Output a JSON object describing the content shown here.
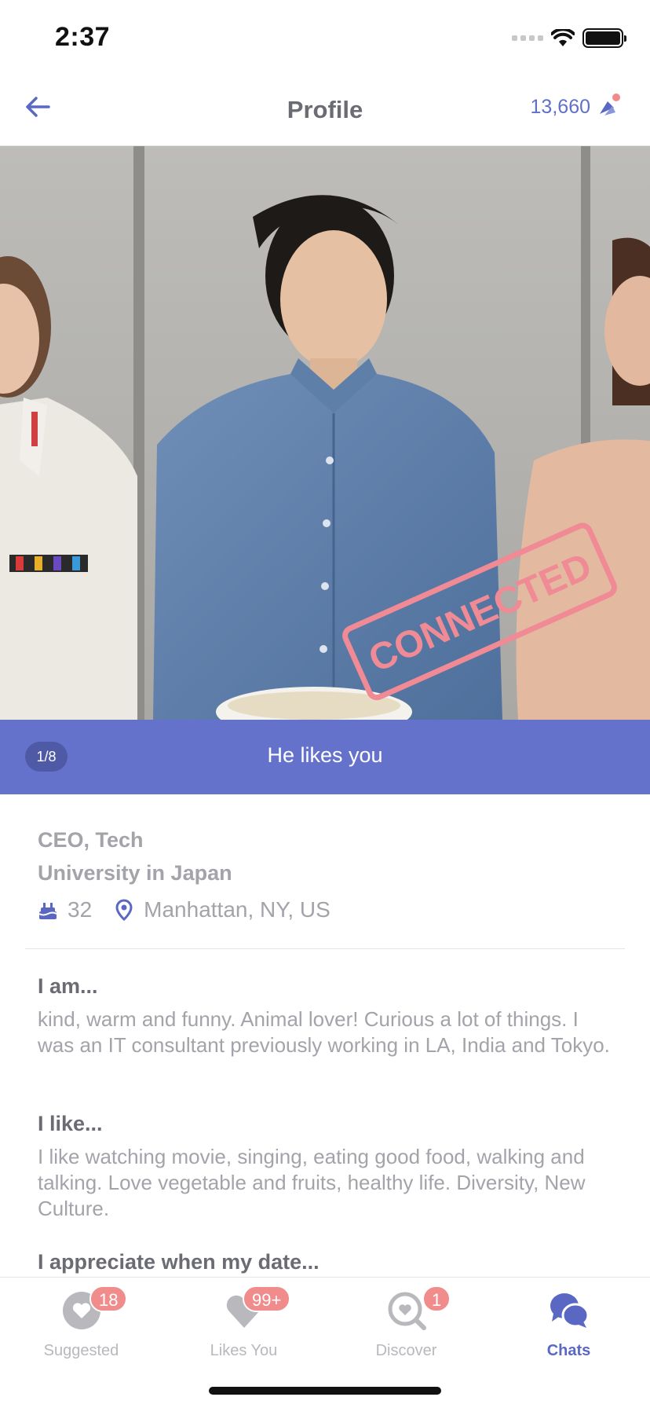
{
  "status_bar": {
    "time": "2:37"
  },
  "header": {
    "title": "Profile",
    "coins": "13,660",
    "icons": {
      "back": "back-arrow-icon",
      "coins": "coin-icon"
    }
  },
  "photo": {
    "counter": "1/8",
    "stamp": "CONNECTED",
    "likes_text": "He likes you"
  },
  "profile": {
    "job": "CEO, Tech",
    "school": "University in Japan",
    "age": "32",
    "location": "Manhattan, NY, US"
  },
  "sections": [
    {
      "heading": "I am...",
      "text": "kind, warm and funny. Animal lover! Curious a lot of things. I was an IT consultant previously working in LA, India and Tokyo."
    },
    {
      "heading": "I like...",
      "text": "I like watching movie, singing, eating good food, walking and talking. Love vegetable and fruits, healthy life. Diversity, New Culture."
    },
    {
      "heading": "I appreciate when my date..."
    }
  ],
  "tabbar": {
    "tabs": [
      {
        "label": "Suggested",
        "badge": "18",
        "icon": "suggested-heart-icon"
      },
      {
        "label": "Likes You",
        "badge": "99+",
        "icon": "likes-heart-icon"
      },
      {
        "label": "Discover",
        "badge": "1",
        "icon": "discover-search-icon"
      },
      {
        "label": "Chats",
        "badge": "",
        "icon": "chats-bubble-icon"
      }
    ]
  },
  "colors": {
    "accent": "#6472cc",
    "badge": "#f08c8c",
    "stamp": "#f08a95"
  }
}
